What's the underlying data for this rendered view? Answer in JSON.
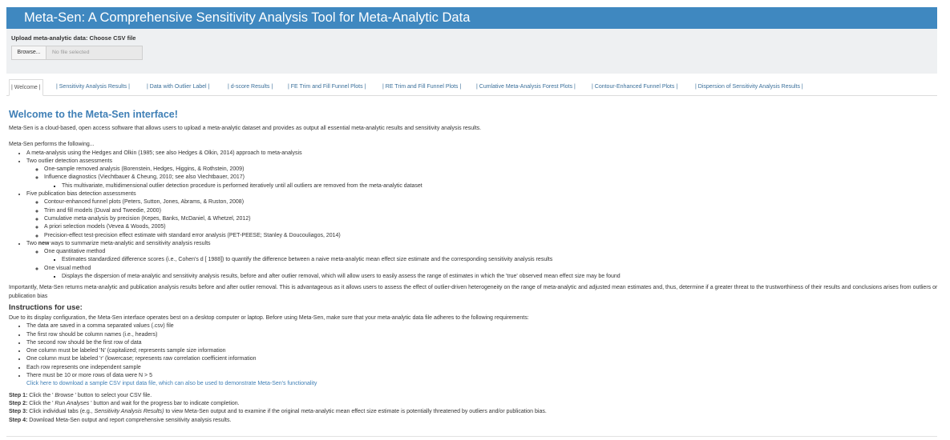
{
  "app": {
    "title": "Meta-Sen: A Comprehensive Sensitivity Analysis Tool for Meta-Analytic Data"
  },
  "upload": {
    "label": "Upload meta-analytic data: Choose CSV file",
    "browse_label": "Browse...",
    "file_placeholder": "No file selected"
  },
  "tabs": [
    {
      "label": "| Welcome |"
    },
    {
      "label": "| Sensitivity Analysis Results |"
    },
    {
      "label": "| Data with Outlier Label |"
    },
    {
      "label": "| d-score Results |"
    },
    {
      "label": "| FE Trim and Fill Funnel Plots |"
    },
    {
      "label": "| RE Trim and Fill Funnel Plots |"
    },
    {
      "label": "| Cumlative Meta-Analysis Forest Plots |"
    },
    {
      "label": "| Contour-Enhanced Funnel Plots |"
    },
    {
      "label": "| Dispersion of Sensitivity Analysis Results |"
    }
  ],
  "welcome": {
    "heading": "Welcome to the Meta-Sen interface!",
    "intro": "Meta-Sen is a cloud-based, open access software that allows users to upload a meta-analytic dataset and provides as output all essential meta-analytic results and sensitivity analysis results.",
    "performs_label": "Meta-Sen performs the following...",
    "items": {
      "a": "A meta-analysis using the Hedges and Olkin (1985; see also Hedges & Olkin, 2014) approach to meta-analysis",
      "b": "Two outlier detection assessments",
      "b1": "One-sample removed analysis (Borenstein, Hedges, Higgins, & Rothstein, 2009)",
      "b2": "Influence diagnostics (Viechtbauer & Cheung, 2010; see also Viechtbauer, 2017)",
      "b2a": "This multivariate, multidimensional outlier detection procedure is performed iteratively until all outliers are removed from the meta-analytic dataset",
      "c": "Five publication bias detection assessments",
      "c1": "Contour-enhanced funnel plots (Peters, Sutton, Jones, Abrams, & Ruston, 2008)",
      "c2": "Trim and fill models (Duval and Tweedie, 2000)",
      "c3": "Cumulative meta-analysis by precision (Kepes, Banks, McDaniel, & Whetzel, 2012)",
      "c4": "A priori selection models (Vevea & Woods, 2005)",
      "c5": "Precision-effect test-precision effect estimate with standard error analysis (PET-PEESE; Stanley & Doucouliagos, 2014)",
      "d_pre": "Two ",
      "d_bold": "new",
      "d_post": " ways to summarize meta-analytic and sensitivity analysis results",
      "d1": "One quantitative method",
      "d1a": "Estimates standardized difference scores (i.e., Cohen's d [ 1988]) to quantify the difference between a naive meta-analytic mean effect size estimate and the corresponding sensitivity analysis results",
      "d2": "One visual method",
      "d2a": "Displays the dispersion of meta-analytic and sensitivity analysis results, before and after outlier removal, which will allow users to easily assess the range of estimates in which the 'true' observed mean effect size may be found"
    },
    "importantly": "Importantly, Meta-Sen returns meta-analytic and publication analysis results before and after outlier removal. This is advantageous as it allows users to assess the effect of outlier-driven heterogeneity on the range of meta-analytic and adjusted mean estimates and, thus, determine if a greater threat to the trustworthiness of their results and conclusions arises from outliers or publication bias"
  },
  "instructions": {
    "heading": "Instructions for use:",
    "intro": "Due to its display configuration, the Meta-Sen interface operates best on a desktop computer or laptop. Before using Meta-Sen, make sure that your meta-analytic data file adheres to the following requirements:",
    "requirements": {
      "r1": "The data are saved in a comma separated values (.csv) file",
      "r2": "The first row should be column names (i.e., headers)",
      "r3": "The second row should be the first row of data",
      "r4": "One column must be labeled 'N' (capitalized; represents sample size information",
      "r5": "One column must be labeled 'r' (lowercase; represents raw correlation coefficient information",
      "r6": "Each row represents one independent sample",
      "r7": "There must be 10 or more rows of data were N > 5"
    },
    "sample_link": "Click here to download a sample CSV input data file, which can also be used to demonstrate Meta-Sen's functionality",
    "steps": {
      "s1_label": "Step 1:",
      "s1_pre": " Click the ' ",
      "s1_em": "Browse",
      "s1_post": " ' button to select your CSV file.",
      "s2_label": "Step 2:",
      "s2_pre": " Click the ' ",
      "s2_em": "Run Analyses",
      "s2_post": " ' button and wait for the progress bar to indicate completion.",
      "s3_label": "Step 3:",
      "s3_pre": " Click individual tabs (e.g., ",
      "s3_em": "Sensitivity Analysis Results)",
      "s3_post": " to view Meta-Sen output and to examine if the original meta-analytic mean effect size estimate is potentially threatened by outliers and/or publication bias.",
      "s4_label": "Step 4:",
      "s4_text": " Download Meta-Sen output and report comprehensive sensitivity analysis results."
    }
  }
}
